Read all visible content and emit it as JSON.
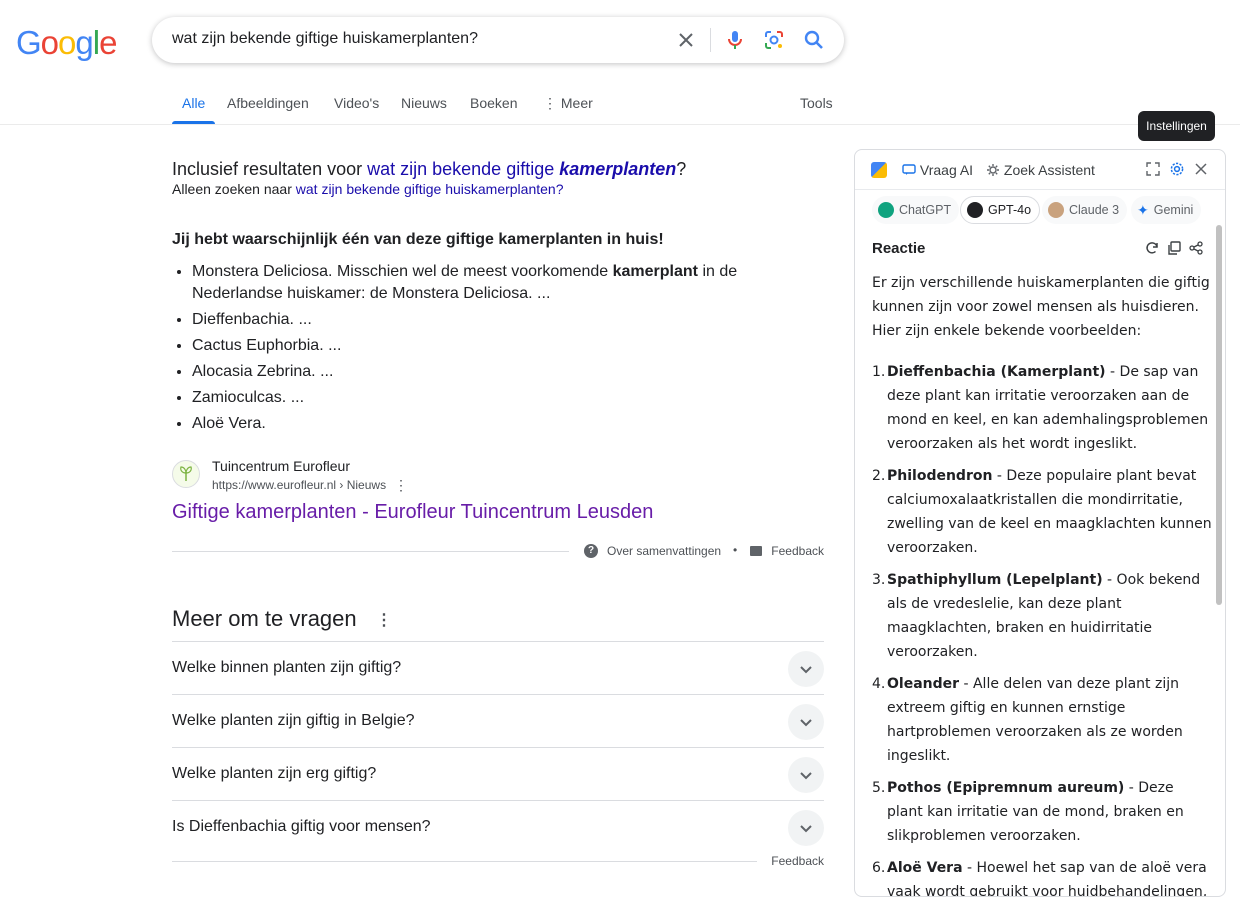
{
  "search": {
    "query": "wat zijn bekende giftige huiskamerplanten?"
  },
  "logo": {
    "letters": [
      "G",
      "o",
      "o",
      "g",
      "l",
      "e"
    ],
    "colors": [
      "#4285f4",
      "#ea4335",
      "#fbbc05",
      "#4285f4",
      "#34a853",
      "#ea4335"
    ]
  },
  "tabs": {
    "all": "Alle",
    "images": "Afbeeldingen",
    "videos": "Video's",
    "news": "Nieuws",
    "books": "Boeken",
    "more": "Meer",
    "tools": "Tools"
  },
  "correction": {
    "prefix": "Inclusief resultaten voor ",
    "link_plain": "wat zijn bekende giftige ",
    "link_bold": "kamerplanten",
    "suffix": "?",
    "only_prefix": "Alleen zoeken naar ",
    "only_link": "wat zijn bekende giftige huiskamerplanten?"
  },
  "snippet": {
    "title": "Jij hebt waarschijnlijk één van deze giftige kamerplanten in huis!",
    "items": [
      {
        "pre": "Monstera Deliciosa. Misschien wel de meest voorkomende ",
        "bold": "kamerplant",
        "post": " in de Nederlandse huiskamer: de Monstera Deliciosa. ..."
      },
      {
        "pre": "Dieffenbachia. ...",
        "bold": "",
        "post": ""
      },
      {
        "pre": "Cactus Euphorbia. ...",
        "bold": "",
        "post": ""
      },
      {
        "pre": "Alocasia Zebrina. ...",
        "bold": "",
        "post": ""
      },
      {
        "pre": "Zamioculcas. ...",
        "bold": "",
        "post": ""
      },
      {
        "pre": "Aloë Vera.",
        "bold": "",
        "post": ""
      }
    ],
    "source_name": "Tuincentrum Eurofleur",
    "source_url": "https://www.eurofleur.nl › Nieuws",
    "result_title": "Giftige kamerplanten - Eurofleur Tuincentrum Leusden",
    "about": "Over samenvattingen",
    "feedback": "Feedback"
  },
  "paa": {
    "title": "Meer om te vragen",
    "questions": [
      "Welke binnen planten zijn giftig?",
      "Welke planten zijn giftig in Belgie?",
      "Welke planten zijn erg giftig?",
      "Is Dieffenbachia giftig voor mensen?"
    ],
    "feedback": "Feedback"
  },
  "tooltip": "Instellingen",
  "panel": {
    "tab_ask": "Vraag AI",
    "tab_assistant": "Zoek Assistent",
    "models": [
      "ChatGPT",
      "GPT-4o",
      "Claude 3",
      "Gemini"
    ],
    "active_model": "GPT-4o",
    "response_label": "Reactie",
    "intro": "Er zijn verschillende huiskamerplanten die giftig kunnen zijn voor zowel mensen als huisdieren. Hier zijn enkele bekende voorbeelden:",
    "items": [
      {
        "num": "1.",
        "name": "Dieffenbachia (Kamerplant)",
        "text": " - De sap van deze plant kan irritatie veroorzaken aan de mond en keel, en kan ademhalingsproblemen veroorzaken als het wordt ingeslikt."
      },
      {
        "num": "2.",
        "name": "Philodendron",
        "text": " - Deze populaire plant bevat calciumoxalaatkristallen die mondirritatie, zwelling van de keel en maagklachten kunnen veroorzaken."
      },
      {
        "num": "3.",
        "name": "Spathiphyllum (Lepelplant)",
        "text": " - Ook bekend als de vredeslelie, kan deze plant maagklachten, braken en huidirritatie veroorzaken."
      },
      {
        "num": "4.",
        "name": "Oleander",
        "text": " - Alle delen van deze plant zijn extreem giftig en kunnen ernstige hartproblemen veroorzaken als ze worden ingeslikt."
      },
      {
        "num": "5.",
        "name": "Pothos (Epipremnum aureum)",
        "text": " - Deze plant kan irritatie van de mond, braken en slikproblemen veroorzaken."
      },
      {
        "num": "6.",
        "name": "Aloë Vera",
        "text": " - Hoewel het sap van de aloë vera vaak wordt gebruikt voor huidbehandelingen, is het inname van de plant giftig en kan het"
      }
    ]
  },
  "colors": {
    "link": "#1a0dab",
    "visited": "#681da8",
    "accent": "#1a73e8"
  }
}
